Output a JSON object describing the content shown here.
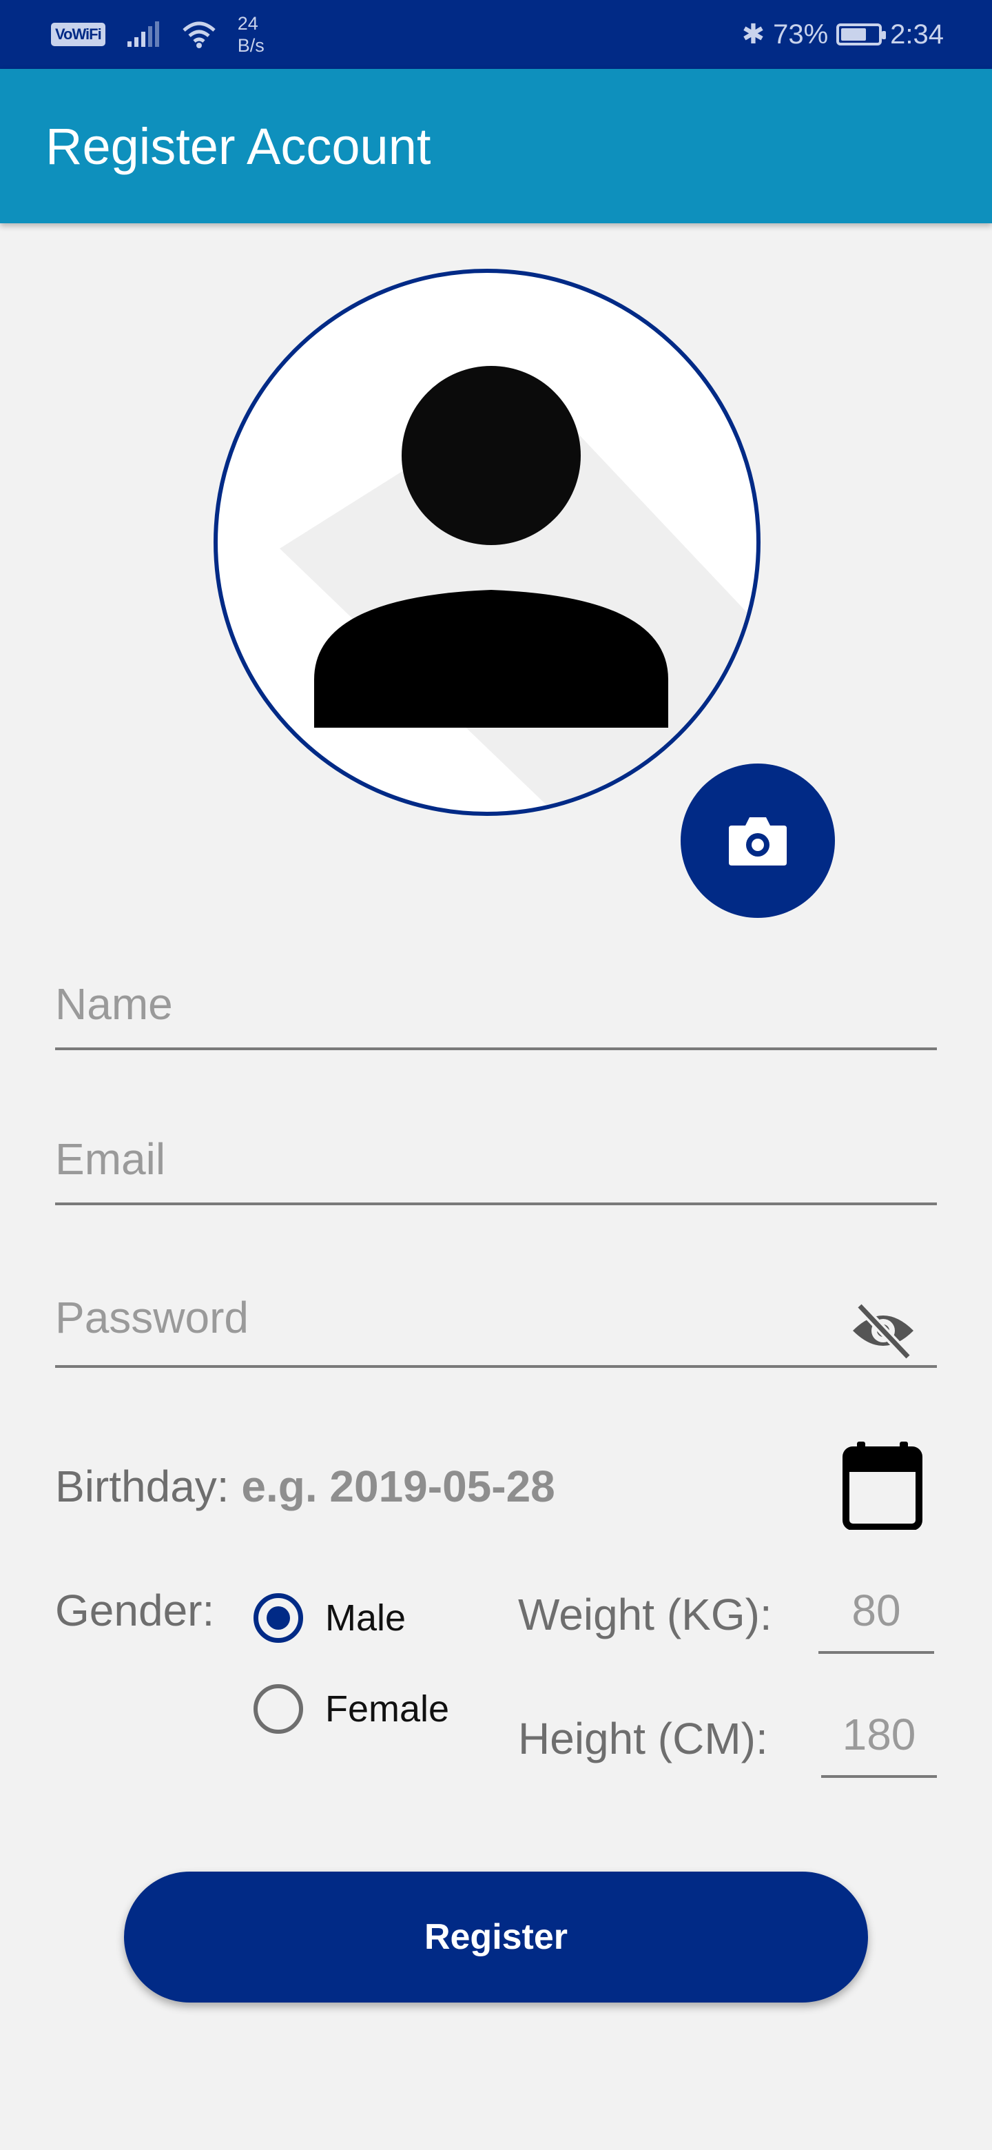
{
  "status_bar": {
    "vowifi": "VoWiFi",
    "net_rate_value": "24",
    "net_rate_unit": "B/s",
    "bluetooth": "✱",
    "battery_percent": "73%",
    "battery_level": 0.73,
    "time": "2:34"
  },
  "app_bar": {
    "title": "Register Account"
  },
  "avatar": {
    "icon": "person-icon",
    "camera_icon": "camera-icon"
  },
  "form": {
    "name_placeholder": "Name",
    "email_placeholder": "Email",
    "password_placeholder": "Password",
    "password_toggle_icon": "eye-off-icon",
    "birthday_label": "Birthday:",
    "birthday_hint": "e.g. 2019-05-28",
    "calendar_icon": "calendar-icon",
    "gender_label": "Gender:",
    "gender_options": [
      {
        "label": "Male",
        "selected": true
      },
      {
        "label": "Female",
        "selected": false
      }
    ],
    "weight_label": "Weight (KG):",
    "weight_placeholder": "80",
    "height_label": "Height (CM):",
    "height_placeholder": "180"
  },
  "register_button": "Register",
  "colors": {
    "primary": "#012a86",
    "app_bar": "#0e90bd",
    "background": "#f2f2f2"
  }
}
